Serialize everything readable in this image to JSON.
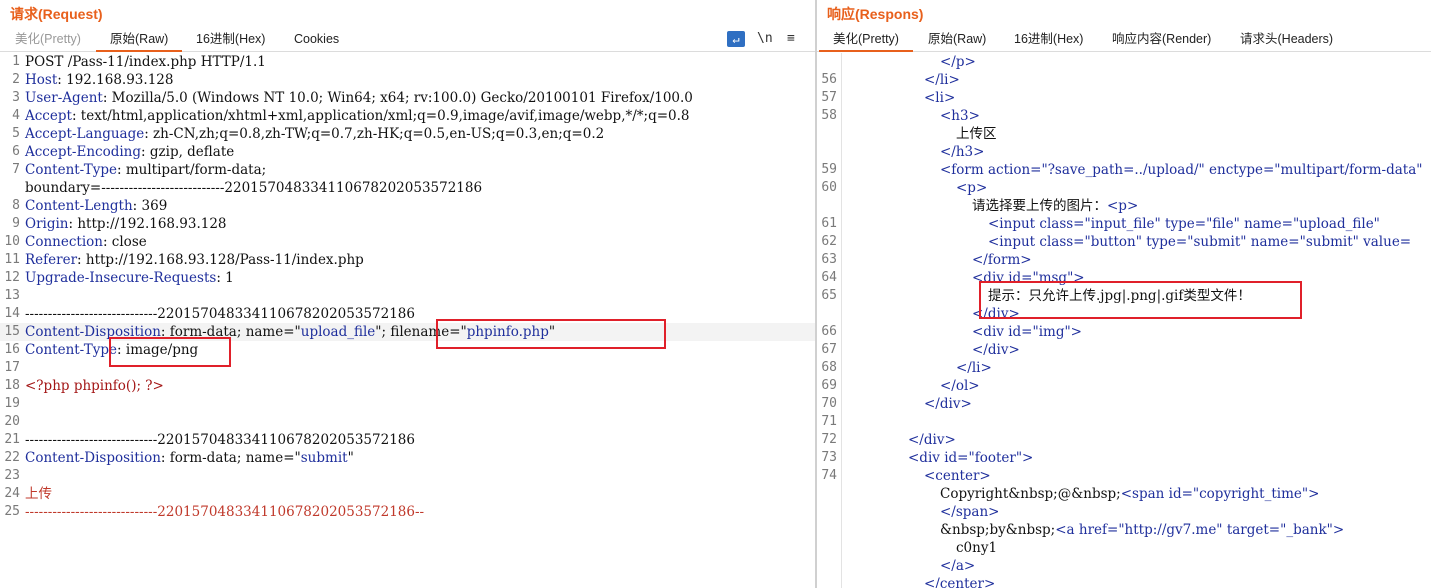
{
  "request": {
    "title": "请求(Request)",
    "tabs": [
      {
        "label": "美化(Pretty)",
        "state": "dim"
      },
      {
        "label": "原始(Raw)",
        "state": "active"
      },
      {
        "label": "16进制(Hex)",
        "state": "normal"
      },
      {
        "label": "Cookies",
        "state": "normal"
      }
    ],
    "tools": {
      "wrap_icon": "wrap-icon",
      "newline_label": "\\n",
      "menu_icon": "menu-icon"
    },
    "lines": [
      {
        "n": "1",
        "parts": [
          {
            "c": "txt",
            "t": "POST /Pass-11/index.php HTTP/1.1"
          }
        ]
      },
      {
        "n": "2",
        "parts": [
          {
            "c": "k",
            "t": "Host"
          },
          {
            "c": "txt",
            "t": ": 192.168.93.128"
          }
        ]
      },
      {
        "n": "3",
        "parts": [
          {
            "c": "k",
            "t": "User-Agent"
          },
          {
            "c": "txt",
            "t": ": Mozilla/5.0 (Windows NT 10.0; Win64; x64; rv:100.0) Gecko/20100101 Firefox/100.0"
          }
        ]
      },
      {
        "n": "4",
        "parts": [
          {
            "c": "k",
            "t": "Accept"
          },
          {
            "c": "txt",
            "t": ": text/html,application/xhtml+xml,application/xml;q=0.9,image/avif,image/webp,*/*;q=0.8"
          }
        ]
      },
      {
        "n": "5",
        "parts": [
          {
            "c": "k",
            "t": "Accept-Language"
          },
          {
            "c": "txt",
            "t": ": zh-CN,zh;q=0.8,zh-TW;q=0.7,zh-HK;q=0.5,en-US;q=0.3,en;q=0.2"
          }
        ]
      },
      {
        "n": "6",
        "parts": [
          {
            "c": "k",
            "t": "Accept-Encoding"
          },
          {
            "c": "txt",
            "t": ": gzip, deflate"
          }
        ]
      },
      {
        "n": "7",
        "parts": [
          {
            "c": "k",
            "t": "Content-Type"
          },
          {
            "c": "txt",
            "t": ": multipart/form-data;"
          }
        ]
      },
      {
        "n": "",
        "parts": [
          {
            "c": "txt",
            "t": "boundary=---------------------------220157048334110678202053572186"
          }
        ]
      },
      {
        "n": "8",
        "parts": [
          {
            "c": "k",
            "t": "Content-Length"
          },
          {
            "c": "txt",
            "t": ": 369"
          }
        ]
      },
      {
        "n": "9",
        "parts": [
          {
            "c": "k",
            "t": "Origin"
          },
          {
            "c": "txt",
            "t": ": http://192.168.93.128"
          }
        ]
      },
      {
        "n": "10",
        "parts": [
          {
            "c": "k",
            "t": "Connection"
          },
          {
            "c": "txt",
            "t": ": close"
          }
        ]
      },
      {
        "n": "11",
        "parts": [
          {
            "c": "k",
            "t": "Referer"
          },
          {
            "c": "txt",
            "t": ": http://192.168.93.128/Pass-11/index.php"
          }
        ]
      },
      {
        "n": "12",
        "parts": [
          {
            "c": "k",
            "t": "Upgrade-Insecure-Requests"
          },
          {
            "c": "txt",
            "t": ": 1"
          }
        ]
      },
      {
        "n": "13",
        "parts": []
      },
      {
        "n": "14",
        "parts": [
          {
            "c": "txt",
            "t": "-----------------------------220157048334110678202053572186"
          }
        ]
      },
      {
        "n": "15",
        "parts": [
          {
            "c": "k",
            "t": "Content-Disposition"
          },
          {
            "c": "txt",
            "t": ": form-data; name=\""
          },
          {
            "c": "s",
            "t": "upload_file"
          },
          {
            "c": "txt",
            "t": "\"; filename=\""
          },
          {
            "c": "s",
            "t": "phpinfo.php"
          },
          {
            "c": "txt",
            "t": "\""
          }
        ],
        "cur": true
      },
      {
        "n": "16",
        "parts": [
          {
            "c": "k",
            "t": "Content-Type"
          },
          {
            "c": "txt",
            "t": ": image/png"
          }
        ]
      },
      {
        "n": "17",
        "parts": []
      },
      {
        "n": "18",
        "parts": [
          {
            "c": "php",
            "t": "<?php phpinfo(); ?>"
          }
        ]
      },
      {
        "n": "19",
        "parts": []
      },
      {
        "n": "20",
        "parts": []
      },
      {
        "n": "21",
        "parts": [
          {
            "c": "txt",
            "t": "-----------------------------220157048334110678202053572186"
          }
        ]
      },
      {
        "n": "22",
        "parts": [
          {
            "c": "k",
            "t": "Content-Disposition"
          },
          {
            "c": "txt",
            "t": ": form-data; name=\""
          },
          {
            "c": "s",
            "t": "submit"
          },
          {
            "c": "txt",
            "t": "\""
          }
        ]
      },
      {
        "n": "23",
        "parts": []
      },
      {
        "n": "24",
        "parts": [
          {
            "c": "red",
            "t": "上传"
          }
        ]
      },
      {
        "n": "25",
        "parts": [
          {
            "c": "red",
            "t": "-----------------------------220157048334110678202053572186--"
          }
        ]
      }
    ]
  },
  "response": {
    "title": "响应(Respons)",
    "tabs": [
      {
        "label": "美化(Pretty)",
        "state": "active"
      },
      {
        "label": "原始(Raw)",
        "state": "normal"
      },
      {
        "label": "16进制(Hex)",
        "state": "normal"
      },
      {
        "label": "响应内容(Render)",
        "state": "normal"
      },
      {
        "label": "请求头(Headers)",
        "state": "normal"
      }
    ],
    "lines": [
      {
        "n": "",
        "indent": 6,
        "parts": [
          {
            "c": "tag",
            "t": "</p>"
          }
        ]
      },
      {
        "n": "56",
        "indent": 5,
        "parts": [
          {
            "c": "tag",
            "t": "</li>"
          }
        ]
      },
      {
        "n": "57",
        "indent": 5,
        "parts": [
          {
            "c": "tag",
            "t": "<li>"
          }
        ]
      },
      {
        "n": "58",
        "indent": 6,
        "parts": [
          {
            "c": "tag",
            "t": "<h3>"
          }
        ]
      },
      {
        "n": "",
        "indent": 7,
        "parts": [
          {
            "c": "txt",
            "t": "上传区"
          }
        ]
      },
      {
        "n": "",
        "indent": 6,
        "parts": [
          {
            "c": "tag",
            "t": "</h3>"
          }
        ]
      },
      {
        "n": "59",
        "indent": 6,
        "parts": [
          {
            "c": "tag",
            "t": "<form "
          },
          {
            "c": "attr",
            "t": "action="
          },
          {
            "c": "str",
            "t": "\"?save_path=../upload/\""
          },
          {
            "c": "attr",
            "t": " enctype="
          },
          {
            "c": "str",
            "t": "\"multipart/form-data\""
          }
        ]
      },
      {
        "n": "60",
        "indent": 7,
        "parts": [
          {
            "c": "tag",
            "t": "<p>"
          }
        ]
      },
      {
        "n": "",
        "indent": 8,
        "parts": [
          {
            "c": "txt",
            "t": "请选择要上传的图片："
          },
          {
            "c": "tag",
            "t": "<p>"
          }
        ]
      },
      {
        "n": "61",
        "indent": 9,
        "parts": [
          {
            "c": "tag",
            "t": "<input "
          },
          {
            "c": "attr",
            "t": "class="
          },
          {
            "c": "str",
            "t": "\"input_file\""
          },
          {
            "c": "attr",
            "t": " type="
          },
          {
            "c": "str",
            "t": "\"file\""
          },
          {
            "c": "attr",
            "t": " name="
          },
          {
            "c": "str",
            "t": "\"upload_file\""
          }
        ]
      },
      {
        "n": "62",
        "indent": 9,
        "parts": [
          {
            "c": "tag",
            "t": "<input "
          },
          {
            "c": "attr",
            "t": "class="
          },
          {
            "c": "str",
            "t": "\"button\""
          },
          {
            "c": "attr",
            "t": " type="
          },
          {
            "c": "str",
            "t": "\"submit\""
          },
          {
            "c": "attr",
            "t": " name="
          },
          {
            "c": "str",
            "t": "\"submit\""
          },
          {
            "c": "attr",
            "t": " value="
          }
        ]
      },
      {
        "n": "63",
        "indent": 8,
        "parts": [
          {
            "c": "tag",
            "t": "</form>"
          }
        ]
      },
      {
        "n": "64",
        "indent": 8,
        "parts": [
          {
            "c": "tag",
            "t": "<div "
          },
          {
            "c": "attr",
            "t": "id="
          },
          {
            "c": "str",
            "t": "\"msg\""
          },
          {
            "c": "tag",
            "t": ">"
          }
        ]
      },
      {
        "n": "65",
        "indent": 9,
        "parts": [
          {
            "c": "txt",
            "t": "提示：只允许上传.jpg|.png|.gif类型文件！"
          }
        ]
      },
      {
        "n": "",
        "indent": 8,
        "parts": [
          {
            "c": "tag",
            "t": "</div>"
          }
        ]
      },
      {
        "n": "66",
        "indent": 8,
        "parts": [
          {
            "c": "tag",
            "t": "<div "
          },
          {
            "c": "attr",
            "t": "id="
          },
          {
            "c": "str",
            "t": "\"img\""
          },
          {
            "c": "tag",
            "t": ">"
          }
        ]
      },
      {
        "n": "67",
        "indent": 8,
        "parts": [
          {
            "c": "tag",
            "t": "</div>"
          }
        ]
      },
      {
        "n": "68",
        "indent": 7,
        "parts": [
          {
            "c": "tag",
            "t": "</li>"
          }
        ]
      },
      {
        "n": "69",
        "indent": 6,
        "parts": [
          {
            "c": "tag",
            "t": "</ol>"
          }
        ]
      },
      {
        "n": "70",
        "indent": 5,
        "parts": [
          {
            "c": "tag",
            "t": "</div>"
          }
        ]
      },
      {
        "n": "71",
        "indent": 0,
        "parts": []
      },
      {
        "n": "72",
        "indent": 4,
        "parts": [
          {
            "c": "tag",
            "t": "</div>"
          }
        ]
      },
      {
        "n": "73",
        "indent": 4,
        "parts": [
          {
            "c": "tag",
            "t": "<div "
          },
          {
            "c": "attr",
            "t": "id="
          },
          {
            "c": "str",
            "t": "\"footer\""
          },
          {
            "c": "tag",
            "t": ">"
          }
        ]
      },
      {
        "n": "74",
        "indent": 5,
        "parts": [
          {
            "c": "tag",
            "t": "<center>"
          }
        ]
      },
      {
        "n": "",
        "indent": 6,
        "parts": [
          {
            "c": "txt",
            "t": "Copyright&nbsp;@&nbsp;"
          },
          {
            "c": "tag",
            "t": "<span "
          },
          {
            "c": "attr",
            "t": "id="
          },
          {
            "c": "str",
            "t": "\"copyright_time\""
          },
          {
            "c": "tag",
            "t": ">"
          }
        ]
      },
      {
        "n": "",
        "indent": 6,
        "parts": [
          {
            "c": "tag",
            "t": "</span>"
          }
        ]
      },
      {
        "n": "",
        "indent": 6,
        "parts": [
          {
            "c": "txt",
            "t": "&nbsp;by&nbsp;"
          },
          {
            "c": "tag",
            "t": "<a "
          },
          {
            "c": "attr",
            "t": "href="
          },
          {
            "c": "str",
            "t": "\"http://gv7.me\""
          },
          {
            "c": "attr",
            "t": " target="
          },
          {
            "c": "str",
            "t": "\"_bank\""
          },
          {
            "c": "tag",
            "t": ">"
          }
        ]
      },
      {
        "n": "",
        "indent": 7,
        "parts": [
          {
            "c": "txt",
            "t": "c0ny1"
          }
        ]
      },
      {
        "n": "",
        "indent": 6,
        "parts": [
          {
            "c": "tag",
            "t": "</a>"
          }
        ]
      },
      {
        "n": "",
        "indent": 5,
        "parts": [
          {
            "c": "tag",
            "t": "</center>"
          }
        ]
      }
    ]
  }
}
